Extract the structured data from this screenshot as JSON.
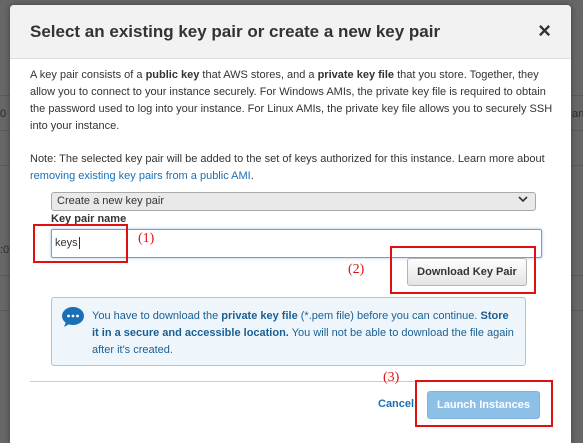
{
  "modal": {
    "title": "Select an existing key pair or create a new key pair",
    "close_glyph": "×",
    "description_parts": {
      "p1": "A key pair consists of a ",
      "b1": "public key",
      "p2": " that AWS stores, and a ",
      "b2": "private key file",
      "p3": " that you store. Together, they allow you to connect to your instance securely. For Windows AMIs, the private key file is required to obtain the password used to log into your instance. For Linux AMIs, the private key file allows you to securely SSH into your instance."
    },
    "note": {
      "text": "Note: The selected key pair will be added to the set of keys authorized for this instance. Learn more about ",
      "link": "removing existing key pairs from a public AMI",
      "end": "."
    },
    "select_value": "Create a new key pair",
    "key_pair_label": "Key pair name",
    "key_pair_value": "keys",
    "download_label": "Download Key Pair",
    "info": {
      "p1": "You have to download the ",
      "b1": "private key file",
      "p2": " (*.pem file) before you can continue. ",
      "b2": "Store it in a secure and accessible location.",
      "p3": " You will not be able to download the file again after it's created."
    },
    "cancel_label": "Cancel",
    "launch_label": "Launch Instances"
  },
  "background": {
    "left_fragment_1": "0",
    "left_fragment_2": ":0",
    "right_fragment": "anc"
  },
  "annotations": [
    "(1)",
    "(2)",
    "(3)"
  ],
  "colors": {
    "link": "#1a6fb5",
    "info_text": "#1a5f94",
    "launch_button": "#8cc0e6",
    "annotation": "#e01010"
  },
  "icons": [
    "close-icon",
    "chevron-down-icon",
    "chat-info-icon"
  ]
}
